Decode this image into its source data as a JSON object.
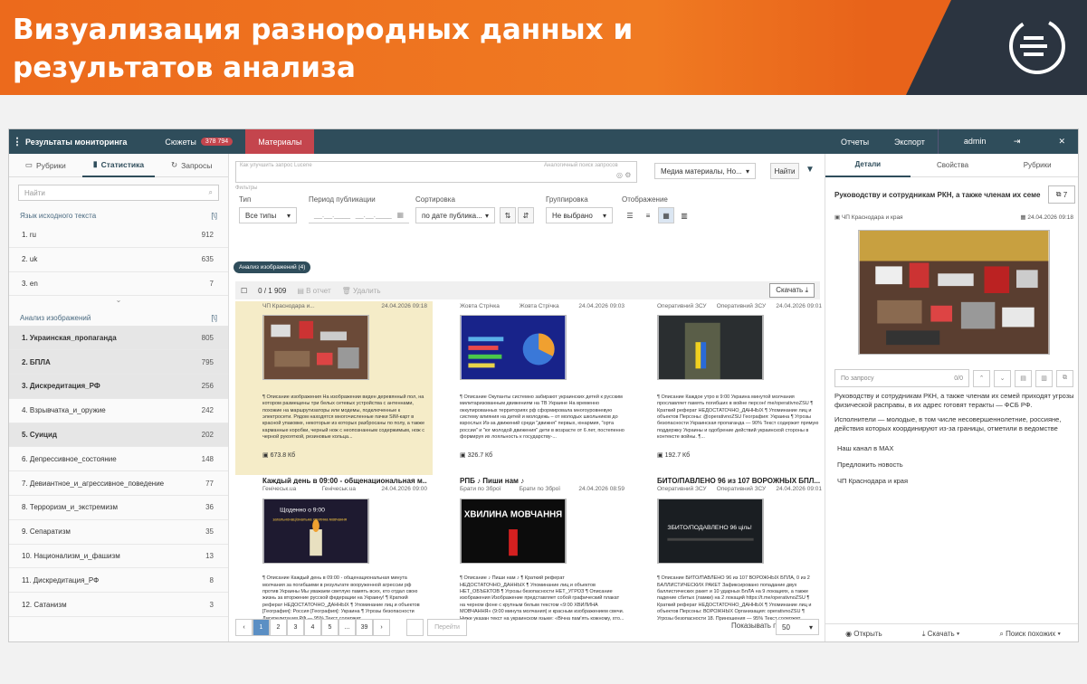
{
  "banner": {
    "title": "Визуализация разнородных данных и результатов анализа"
  },
  "topbar": {
    "title": "Результаты мониторинга",
    "tab_stories": "Сюжеты",
    "stories_count": "378 794",
    "tab_materials": "Материалы",
    "reports": "Отчеты",
    "export": "Экспорт",
    "user": "admin"
  },
  "left": {
    "tabs": [
      "Рубрики",
      "Статистика",
      "Запросы"
    ],
    "search_placeholder": "Найти",
    "lang_section": "Язык исходного текста",
    "langs": [
      {
        "label": "1.  ru",
        "count": "912"
      },
      {
        "label": "2.  uk",
        "count": "635"
      },
      {
        "label": "3.  en",
        "count": "7"
      }
    ],
    "image_section": "Анализ изображений",
    "items": [
      {
        "label": "1.  Украинская_пропаганда",
        "count": "805",
        "hl": true
      },
      {
        "label": "2.  БПЛА",
        "count": "795",
        "hl": true
      },
      {
        "label": "3.  Дискредитация_РФ",
        "count": "256",
        "hl": true
      },
      {
        "label": "4.  Взрывчатка_и_оружие",
        "count": "242",
        "hl": false
      },
      {
        "label": "5.  Суицид",
        "count": "202",
        "hl": true
      },
      {
        "label": "6.  Депрессивное_состояние",
        "count": "148",
        "hl": false
      },
      {
        "label": "7.  Девиантное_и_агрессивное_поведение",
        "count": "77",
        "hl": false
      },
      {
        "label": "8.  Терроризм_и_экстремизм",
        "count": "36",
        "hl": false
      },
      {
        "label": "9.  Сепаратизм",
        "count": "35",
        "hl": false
      },
      {
        "label": "10.  Национализм_и_фашизм",
        "count": "13",
        "hl": false
      },
      {
        "label": "11.  Дискредитация_РФ",
        "count": "8",
        "hl": false
      },
      {
        "label": "12.  Сатанизм",
        "count": "3",
        "hl": false
      }
    ]
  },
  "center": {
    "search_hint": "Как улучшить запрос Lucene",
    "search_hint2": "Аналогичный поиск запросов",
    "source_select": "Медиа материалы, Но...",
    "find_button": "Найти",
    "filters_label": "Фильтры",
    "type_label": "Тип",
    "type_value": "Все типы",
    "period_label": "Период публикации",
    "period_from": "__.__.____",
    "period_to": "__.__.____",
    "sort_label": "Сортировка",
    "sort_value": "по дате публика...",
    "group_label": "Группировка",
    "group_value": "Не выбрано",
    "display_label": "Отображение",
    "chip": "Анализ изображений (4)",
    "count": "0 / 1 909",
    "in_report": "В отчет",
    "delete": "Удалить",
    "download": "Скачать",
    "cards": [
      {
        "src": "ЧП Краснодара и...",
        "date": "24.04.2026 09:18",
        "title": "",
        "desc": "¶ Описание изображения На изображении виден деревянный пол, на котором размещены три белых сетевых устройства с антеннами, похожие на маршрутизаторы или модемы, подключенные к электросети. Рядом находятся многочисленные пачки SIM-карт в красной упаковке, некоторые из которых разбросаны по полу, а также карманные коробки, черный нож с неопознанным содержимым, нож с черной рукояткой, резиновые кольца...",
        "size": "673.8 Кб"
      },
      {
        "src": "Жовта Стрічка",
        "src2": "Жовта Стрічка",
        "date": "24.04.2026 09:03",
        "title": "",
        "desc": "¶ Описание Окупанты системно забирают украинских детей к русским милитаризованным движениям на ТВ Украине На временно оккупированных территориях рф сформировала многоуровневую систему влияния на детей и молодежь – от молодых школьников до взрослых Из-за движений среди \"движня\" первых, юнармия, \"орта россии\" и \"юг молодой движения\" дети в возрасте от 6 лет, постепенно формируя их лояльность к государству-...",
        "size": "326.7 Кб"
      },
      {
        "src": "Оперативний ЗСУ",
        "src2": "Оперативний ЗСУ",
        "date": "24.04.2026 09:01",
        "title": "",
        "desc": "¶ Описание Каждое утро в 9:00 Украина минутой молчания прославляет память погибших в войне персон! me/operativnoZSU ¶ Краткий реферат НЕДОСТАТОЧНО_ДАННЫХ ¶ Упоминание лиц и объектов Персоны: @operativnoZSU География: Украина ¶ Угрозы безопасности Украинская пропаганда — 90% Текст содержит прямую поддержку Украины и одобрение действий украинской стороны в контексте войны. ¶...",
        "size": "192.7 Кб"
      },
      {
        "src": "Генічеськ.ua",
        "src2": "Генічеськ.ua",
        "date": "24.04.2026 09:00",
        "title": "Каждый день в 09:00 - общенациональная м...",
        "desc": "¶ Описание Каждый день в 09:00 - общенациональная минута молчания за погибшими в результате вооруженной агрессии рф против Украины Мы уважаем светлую память всех, кто отдал свою жизнь за вторжение русской федерации на Украину! ¶ Краткий реферат НЕДОСТАТОЧНО_ДАННЫХ ¶ Упоминание лиц и объектов [География]: Россия [География]: Украина ¶ Угрозы безопасности Дискредитация РФ — 95% Текст содержит...",
        "size": ""
      },
      {
        "src": "Брати по Зброї",
        "src2": "Брати по Зброї",
        "date": "24.04.2026 08:59",
        "title": "РПБ ♪ Пиши нам ♪",
        "desc": "¶ Описание ♪ Пиши нам ♪ ¶ Краткий реферат НЕДОСТАТОЧНО_ДАННЫХ ¶ Упоминание лиц и объектов НЕТ_ОБЪЕКТОВ ¶ Угрозы безопасности НЕТ_УГРОЗ ¶ Описание изображения Изображение представляет собой графический плакат на черном фоне с крупным белым текстом «9:00 ХВИЛИНА МОВЧАННЯ» (9:00 минута молчания) и красным изображением свечи. Ниже указан текст на украинском языке: «Вічна пам'ять кожному, хто...",
        "size": ""
      },
      {
        "src": "Оперативний ЗСУ",
        "src2": "Оперативний ЗСУ",
        "date": "24.04.2026 09:01",
        "title": "БИТО/ПАВЛЕНО 96 из 107 ВОРОЖНЫХ БПЛ...",
        "desc": "¶ Описание БИТО/ПАВЛЕНО 96 из 107 ВОРОЖНЫХ БПЛА, 0 из 2 БАЛЛИСТИЧЕСКИХ РАКЕТ Зафиксировано попадание двух баллистических ракет и 10 ударных БпЛА на 9 локациях, а также падение сбитых (ламки) на 2 локаций https://t.me/operativnoZSU ¶ Краткий реферат НЕДОСТАТОЧНО_ДАННЫХ ¶ Упоминание лиц и объектов Персоны: ВОРОЖНЫХ Организация: operativnoZSU ¶ Угрозы безопасности 18. Приношения — 95% Текст содержит...",
        "size": ""
      }
    ],
    "poster1_top": "Щоденно о 9:00",
    "poster1_bottom": "загальнонаціональна хвилина мовчання",
    "poster2": "ХВИЛИНА МОВЧАННЯ",
    "poster3": "ЗБИТО/ПОДАВЛЕНО 96 ціль!",
    "pages": [
      "1",
      "2",
      "3",
      "4",
      "5",
      "...",
      "39"
    ],
    "go_button": "Перейти",
    "show_by": "Показывать по",
    "page_size": "50"
  },
  "right": {
    "tabs": [
      "Детали",
      "Свойства",
      "Рубрики"
    ],
    "title": "Руководству и сотрудникам РКН, а также членам их семе...",
    "count": "7",
    "source": "ЧП Краснодара и края",
    "date": "24.04.2026 09:18",
    "query_placeholder": "По запросу",
    "query_count": "0/0",
    "text1": "Руководству и сотрудникам РКН, а также членам их семей приходят угрозы физической расправы, в их адрес готовят теракты — ФСБ РФ.",
    "text2": "Исполнители — молодые, в том числе несовершеннолетние, россияне, действия которых координируют из-за границы, отметили в ведомстве",
    "links": [
      "Наш канал в MAX",
      "Предложить новость",
      "ЧП Краснодара и края"
    ],
    "open": "Открыть",
    "download": "Скачать",
    "similar": "Поиск похожих"
  }
}
